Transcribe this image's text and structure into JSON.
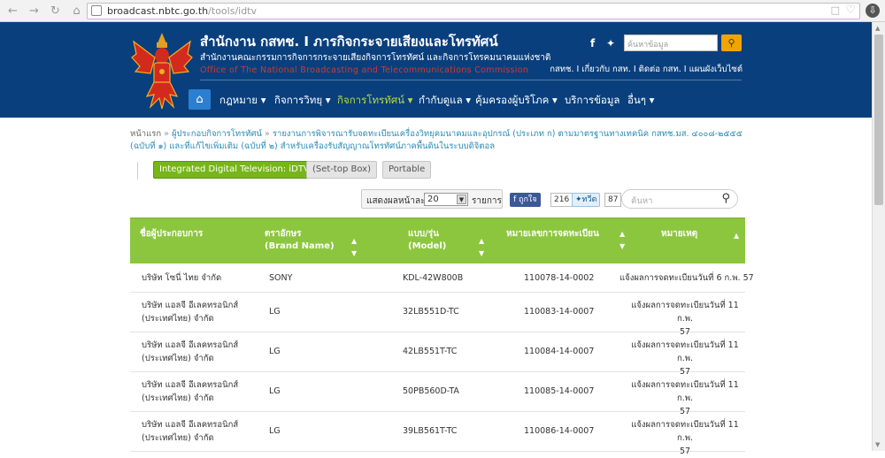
{
  "browser": {
    "url_host": "broadcast.nbtc.go.th",
    "url_path": "/tools/idtv"
  },
  "header": {
    "title": "สำนักงาน กสทช. I ภารกิจกระจายเสียงและโทรทัศน์",
    "subtitle": "สำนักงานคณะกรรมการกิจการกระจายเสียงกิจการโทรทัศน์ และกิจการโทรคมนาคมแห่งชาติ",
    "english": "Office of The National Broadcasting and Telecommunications Commission",
    "search_placeholder": "ค้นหาข้อมูล",
    "toplinks": "กสทช. I เกี่ยวกับ กสท. I ติดต่อ กสท. I แผนผังเว็บไซต์",
    "menu": [
      {
        "label": "กฎหมาย ▾"
      },
      {
        "label": "กิจการวิทยุ ▾"
      },
      {
        "label": "กิจการโทรทัศน์ ▾"
      },
      {
        "label": "กำกับดูแล ▾"
      },
      {
        "label": "คุ้มครองผู้บริโภค ▾"
      },
      {
        "label": "บริการข้อมูล"
      },
      {
        "label": "อื่นๆ ▾"
      }
    ]
  },
  "breadcrumb": {
    "home": "หน้าแรก",
    "level2": "ผู้ประกอบกิจการโทรทัศน์",
    "current": "รายงานการพิจารณารับจดทะเบียนเครื่องวิทยุคมนาคมและอุปกรณ์ (ประเภท ก) ตามมาตรฐานทางเทคนิค กสทช.มส. ๔๐๐๘-๒๕๕๕ (ฉบับที่ ๑) และที่แก้ไขเพิ่มเติม (ฉบับที่ ๒) สำหรับเครื่องรับสัญญาณโทรทัศน์ภาคพื้นดินในระบบดิจิตอล"
  },
  "tabs": {
    "idtv": "Integrated Digital Television: iDTV",
    "stb": "(Set-top Box)",
    "portable": "Portable"
  },
  "controls": {
    "show_label": "แสดงผลหน้าละ",
    "per_page": "20",
    "items_label": "รายการ",
    "fb_label": "ถูกใจ",
    "fb_count": "216",
    "tw_label": "ทวีต",
    "tw_count": "87",
    "search_placeholder": "ค้นหา"
  },
  "table": {
    "headers": {
      "company": "ชื่อผู้ประกอบการ",
      "brand": "ตราอักษร",
      "brand_en": "(Brand Name)",
      "model": "แบบ/รุ่น",
      "model_en": "(Model)",
      "reg": "หมายเลขการจดทะเบียน",
      "note": "หมายเหตุ"
    },
    "rows": [
      {
        "company1": "บริษัท โซนี่ ไทย จำกัด",
        "company2": "",
        "brand": "SONY",
        "model": "KDL-42W800B",
        "reg": "110078-14-0002",
        "note1": "แจ้งผลการจดทะเบียนวันที่ 6 ก.พ. 57",
        "note2": ""
      },
      {
        "company1": "บริษัท แอลจี อีเลคทรอนิกส์",
        "company2": "(ประเทศไทย) จำกัด",
        "brand": "LG",
        "model": "32LB551D-TC",
        "reg": "110083-14-0007",
        "note1": "แจ้งผลการจดทะเบียนวันที่ 11 ก.พ.",
        "note2": "57"
      },
      {
        "company1": "บริษัท แอลจี อีเลคทรอนิกส์",
        "company2": "(ประเทศไทย) จำกัด",
        "brand": "LG",
        "model": "42LB551T-TC",
        "reg": "110084-14-0007",
        "note1": "แจ้งผลการจดทะเบียนวันที่ 11 ก.พ.",
        "note2": "57"
      },
      {
        "company1": "บริษัท แอลจี อีเลคทรอนิกส์",
        "company2": "(ประเทศไทย) จำกัด",
        "brand": "LG",
        "model": "50PB560D-TA",
        "reg": "110085-14-0007",
        "note1": "แจ้งผลการจดทะเบียนวันที่ 11 ก.พ.",
        "note2": "57"
      },
      {
        "company1": "บริษัท แอลจี อีเลคทรอนิกส์",
        "company2": "(ประเทศไทย) จำกัด",
        "brand": "LG",
        "model": "39LB561T-TC",
        "reg": "110086-14-0007",
        "note1": "แจ้งผลการจดทะเบียนวันที่ 11 ก.พ.",
        "note2": "57"
      }
    ]
  }
}
